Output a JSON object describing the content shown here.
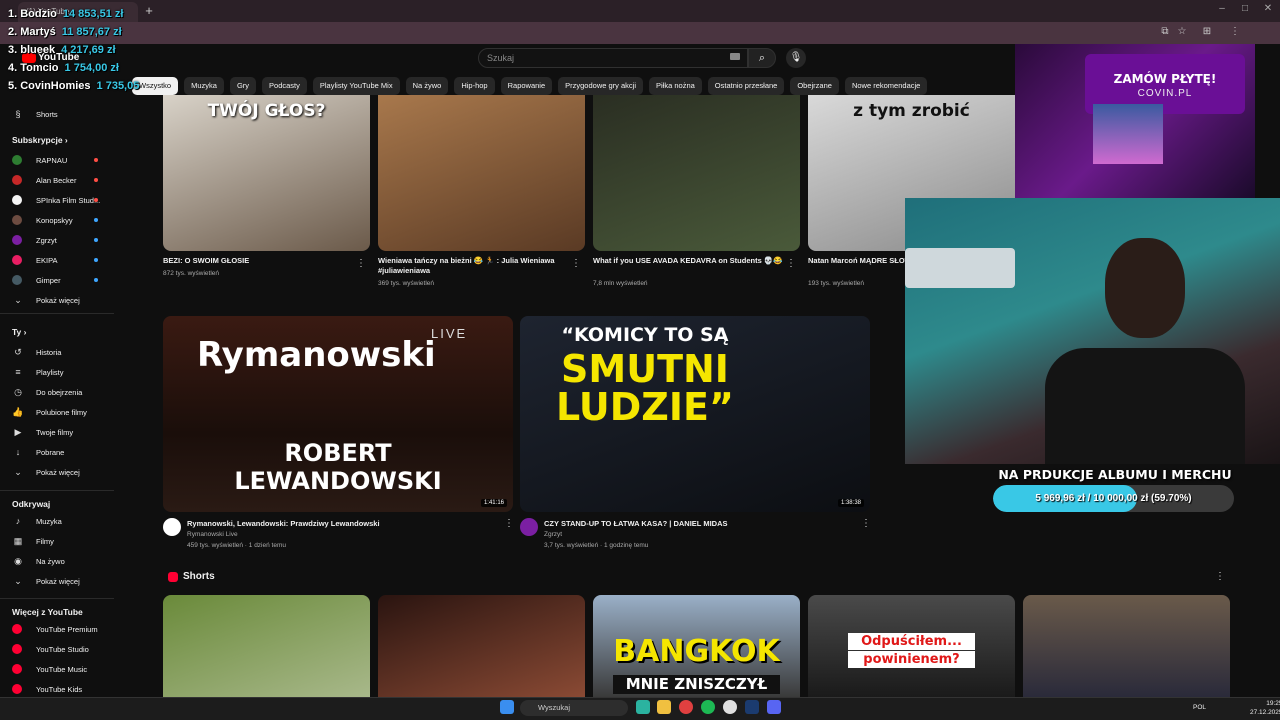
{
  "browser": {
    "tab_title": "(1) YouTube",
    "new_tab": "+",
    "window_controls": [
      "–",
      "□",
      "✕"
    ]
  },
  "leaderboard": [
    {
      "rank_name": "1. Bodzio",
      "amount": "14 853,51 zł"
    },
    {
      "rank_name": "2. Martyś",
      "amount": "11 857,67 zł"
    },
    {
      "rank_name": "3. blueek",
      "amount": "4 217,69 zł"
    },
    {
      "rank_name": "4. Tomcio",
      "amount": "1 754,00 zł"
    },
    {
      "rank_name": "5. CovinHomies",
      "amount": "1 735,05"
    }
  ],
  "header": {
    "logo": "YouTube",
    "search_placeholder": "Szukaj"
  },
  "chips": [
    "Wszystko",
    "Muzyka",
    "Gry",
    "Podcasty",
    "Playlisty YouTube Mix",
    "Na żywo",
    "Hip-hop",
    "Rapowanie",
    "Przygodowe gry akcji",
    "Piłka nożna",
    "Ostatnio przesłane",
    "Obejrzane",
    "Nowe rekomendacje"
  ],
  "sidebar": {
    "shorts": "Shorts",
    "subscriptions_heading": "Subskrypcje",
    "subscriptions": [
      {
        "label": "RAPNAU",
        "avatar_color": "#2e7d32",
        "dot_color": "#ff4e45"
      },
      {
        "label": "Alan Becker",
        "avatar_color": "#c62828",
        "dot_color": "#ff4e45"
      },
      {
        "label": "SPInka Film Stud...",
        "avatar_color": "#f5f5f5",
        "dot_color": "#ff4e45"
      },
      {
        "label": "Konopskyy",
        "avatar_color": "#6d4c41",
        "dot_color": "#3ea6ff"
      },
      {
        "label": "Zgrzyt",
        "avatar_color": "#7b1fa2",
        "dot_color": "#3ea6ff"
      },
      {
        "label": "EKIPA",
        "avatar_color": "#e91e63",
        "dot_color": "#3ea6ff"
      },
      {
        "label": "Gimper",
        "avatar_color": "#455a64",
        "dot_color": "#3ea6ff"
      }
    ],
    "show_more_subs": "Pokaż więcej",
    "you_heading": "Ty",
    "you_items": [
      {
        "label": "Historia",
        "icon": "history-icon"
      },
      {
        "label": "Playlisty",
        "icon": "playlist-icon"
      },
      {
        "label": "Do obejrzenia",
        "icon": "clock-icon"
      },
      {
        "label": "Polubione filmy",
        "icon": "thumbs-up-icon"
      },
      {
        "label": "Twoje filmy",
        "icon": "video-icon"
      },
      {
        "label": "Pobrane",
        "icon": "download-icon"
      },
      {
        "label": "Pokaż więcej",
        "icon": "chevron-down-icon"
      }
    ],
    "explore_heading": "Odkrywaj",
    "explore_items": [
      {
        "label": "Muzyka",
        "icon": "music-icon"
      },
      {
        "label": "Filmy",
        "icon": "film-icon"
      },
      {
        "label": "Na żywo",
        "icon": "live-icon"
      },
      {
        "label": "Pokaż więcej",
        "icon": "chevron-down-icon"
      }
    ],
    "more_heading": "Więcej z YouTube",
    "more_items": [
      "YouTube Premium",
      "YouTube Studio",
      "YouTube Music",
      "YouTube Kids"
    ]
  },
  "videos_row1": [
    {
      "title": "BEZI: O SWOIM GŁOSIE",
      "meta": "872 tys. wyświetleń",
      "thumb_text": "TWÓJ GŁOS?"
    },
    {
      "title": "Wieniawa tańczy na bieżni 😂 🏃 : Julia Wieniawa #juliawieniawa",
      "meta": "369 tys. wyświetleń"
    },
    {
      "title": "What if you USE AVADA KEDAVRA on Students 💀😂",
      "meta": "7,8 mln wyświetleń"
    },
    {
      "title": "Natan Marcoń MĄDRE SŁOWA #motywacja",
      "meta": "193 tys. wyświetleń",
      "thumb_text": "z tym zrobić"
    }
  ],
  "videos_row2": [
    {
      "title": "Rymanowski, Lewandowski: Prawdziwy Lewandowski",
      "channel": "Rymanowski Live",
      "meta": "459 tys. wyświetleń · 1 dzień temu",
      "duration": "1:41:16",
      "thumb_brand": "Rymanowski",
      "thumb_live": "LIVE",
      "thumb_name1": "ROBERT",
      "thumb_name2": "LEWANDOWSKI"
    },
    {
      "title": "CZY STAND-UP TO ŁATWA KASA? | DANIEL MIDAS",
      "channel": "Zgrzyt",
      "meta": "3,7 tys. wyświetleń · 1 godzinę temu",
      "duration": "1:38:38",
      "thumb_line1": "“KOMICY TO SĄ",
      "thumb_line2": "SMUTNI",
      "thumb_line3": "LUDZIE”"
    }
  ],
  "shorts": {
    "heading": "Shorts",
    "thumbs": [
      {
        "text": ""
      },
      {
        "text": ""
      },
      {
        "text1": "BANGKOK",
        "text2": "MNIE ZNISZCZYŁ"
      },
      {
        "text1": "Odpuściłem...",
        "text2": "powinienem?"
      },
      {
        "text": ""
      }
    ]
  },
  "stream_overlay": {
    "promo_line1": "ZAMÓW PŁYTĘ!",
    "promo_line2": "COVIN.PL",
    "goal_label": "NA PRDUKCJE ALBUMU I MERCHU",
    "goal_text": "5 969,96 zł / 10 000,00 zł (59.70%)",
    "goal_fraction": 0.597
  },
  "taskbar": {
    "search": "Wyszukaj",
    "lang": "POL",
    "time": "19:25",
    "date": "27.12.2025"
  }
}
